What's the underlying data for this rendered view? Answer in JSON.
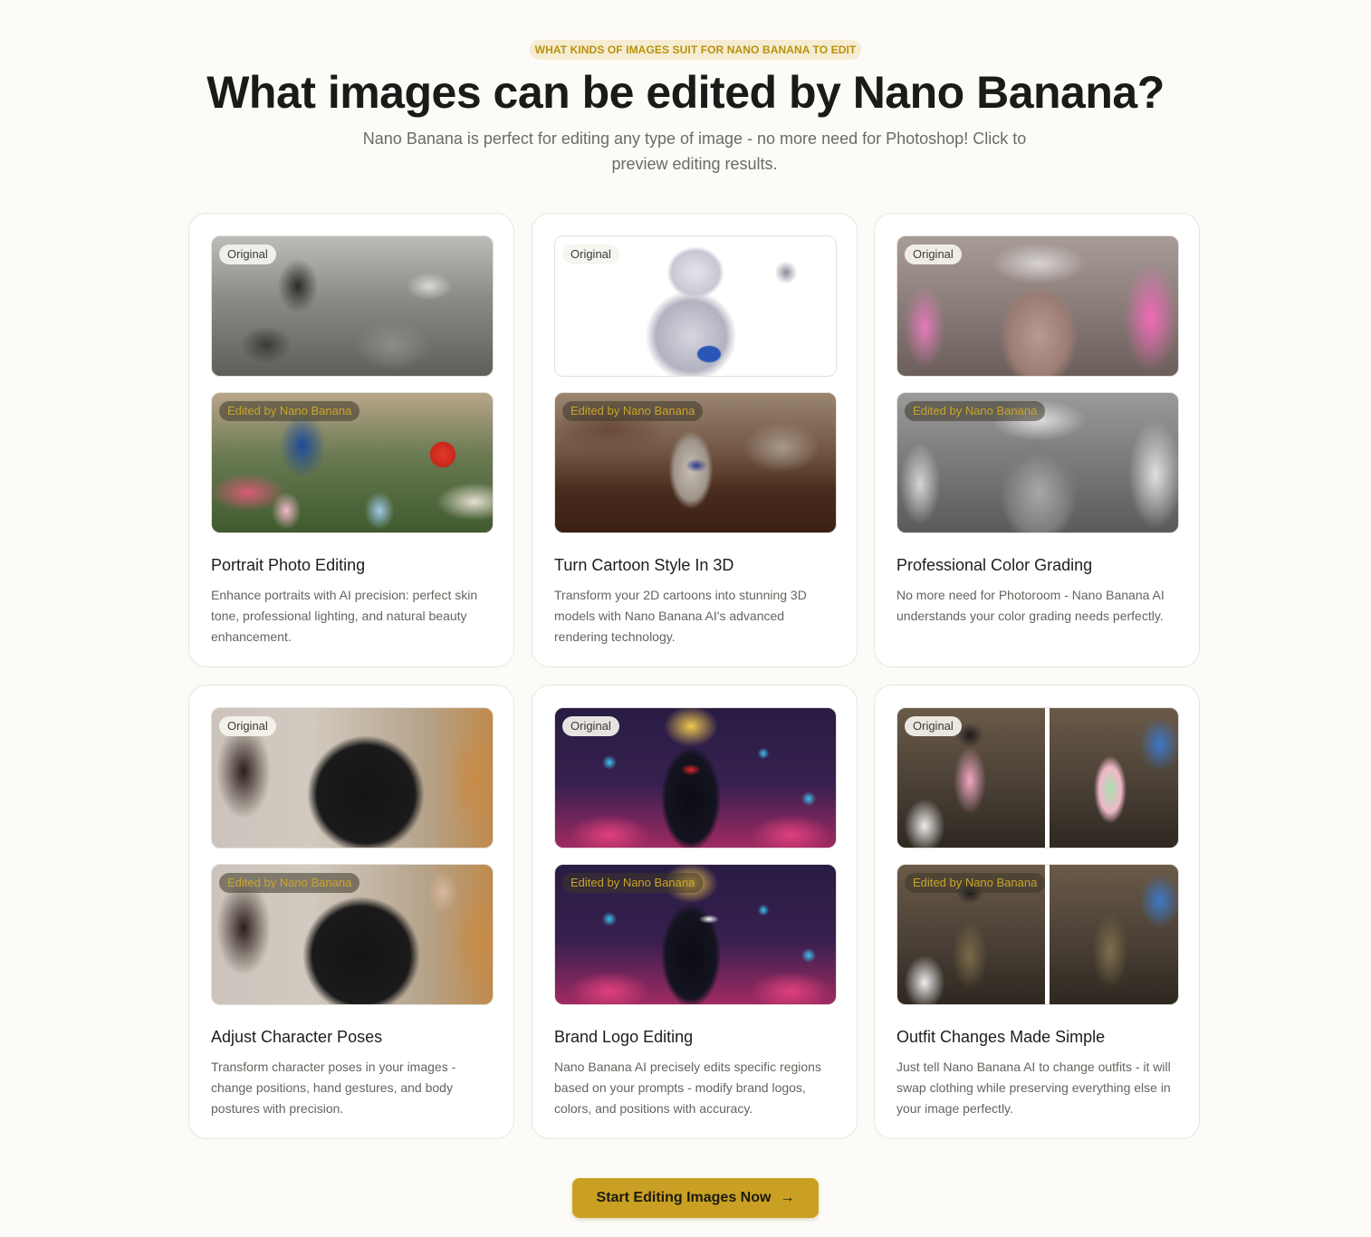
{
  "header": {
    "eyebrow": "WHAT KINDS OF IMAGES SUIT FOR NANO BANANA TO EDIT",
    "title": "What images can be edited by Nano Banana?",
    "subtitle": "Nano Banana is perfect for editing any type of image - no more need for Photoshop! Click to preview editing results."
  },
  "labels": {
    "original": "Original",
    "edited": "Edited by Nano Banana"
  },
  "cards": [
    {
      "title": "Portrait Photo Editing",
      "description": "Enhance portraits with AI precision: perfect skin tone, professional lighting, and natural beauty enhancement.",
      "original_image": "black-and-white family photo in a garden",
      "edited_image": "colorized family photo with flowers and red balloon"
    },
    {
      "title": "Turn Cartoon Style In 3D",
      "description": "Transform your 2D cartoons into stunning 3D models with Nano Banana AI's advanced rendering technology.",
      "original_image": "2D anime wolf girl character illustration",
      "edited_image": "3D figurine of wolf girl on a table"
    },
    {
      "title": "Professional Color Grading",
      "description": "No more need for Photoroom - Nano Banana AI understands your color grading needs perfectly.",
      "original_image": "torso with pink lightning effects",
      "edited_image": "monochrome grayscale graded torso"
    },
    {
      "title": "Adjust Character Poses",
      "description": "Transform character poses in your images - change positions, hand gestures, and body postures with precision.",
      "original_image": "woman in black t-shirt standing",
      "edited_image": "woman in black t-shirt raising hand"
    },
    {
      "title": "Brand Logo Editing",
      "description": "Nano Banana AI precisely edits specific regions based on your prompts - modify brand logos, colors, and positions with accuracy.",
      "original_image": "anime heroine in black suit with red logo among robots",
      "edited_image": "anime heroine in black track jacket with white swoosh logo"
    },
    {
      "title": "Outfit Changes Made Simple",
      "description": "Just tell Nano Banana AI to change outfits - it will swap clothing while preserving everything else in your image perfectly.",
      "original_image": "woman in nun headpiece and pastel outfit praying in church",
      "edited_image": "woman in camouflage outfit praying in church"
    }
  ],
  "cta": {
    "label": "Start Editing Images Now",
    "icon": "arrow-right-icon"
  },
  "colors": {
    "accent": "#c9a023",
    "eyebrow_bg": "#f6ecd2",
    "eyebrow_text": "#b8920c",
    "background": "#fcfbf7"
  }
}
